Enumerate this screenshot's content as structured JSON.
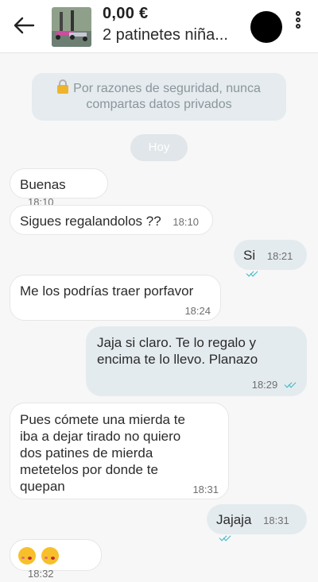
{
  "header": {
    "price": "0,00 €",
    "title": "2 patinetes niña..."
  },
  "security_notice": {
    "icon": "lock-icon",
    "line1": "Por razones de seguridad, nunca",
    "line2": "compartas datos privados"
  },
  "day_separator": "Hoy",
  "messages": [
    {
      "direction": "incoming",
      "text": "Buenas",
      "time": "18:10"
    },
    {
      "direction": "incoming",
      "text": "Sigues regalandolos ??",
      "time": "18:10"
    },
    {
      "direction": "outgoing",
      "text": "Si",
      "time": "18:21",
      "read": true
    },
    {
      "direction": "incoming",
      "text": "Me los podrías traer porfavor",
      "time": "18:24"
    },
    {
      "direction": "outgoing",
      "text_lines": [
        "Jaja si claro. Te lo regalo y",
        "encima te lo llevo. Planazo"
      ],
      "time": "18:29",
      "read": true
    },
    {
      "direction": "incoming",
      "text_lines": [
        "Pues cómete una mierda te",
        "iba a dejar tirado no quiero",
        "dos patines de mierda",
        "metetelos por donde te",
        "quepan"
      ],
      "time": "18:31"
    },
    {
      "direction": "outgoing",
      "text": "Jajaja",
      "time": "18:31",
      "read": true
    },
    {
      "direction": "incoming",
      "emoji": [
        "kissing-face-emoji",
        "kissing-face-emoji"
      ],
      "time": "18:32"
    }
  ],
  "colors": {
    "outgoing_bubble": "#e4ebef",
    "incoming_bubble": "#ffffff",
    "read_ticks": "#38b6c4",
    "background": "#f7f7f7"
  }
}
